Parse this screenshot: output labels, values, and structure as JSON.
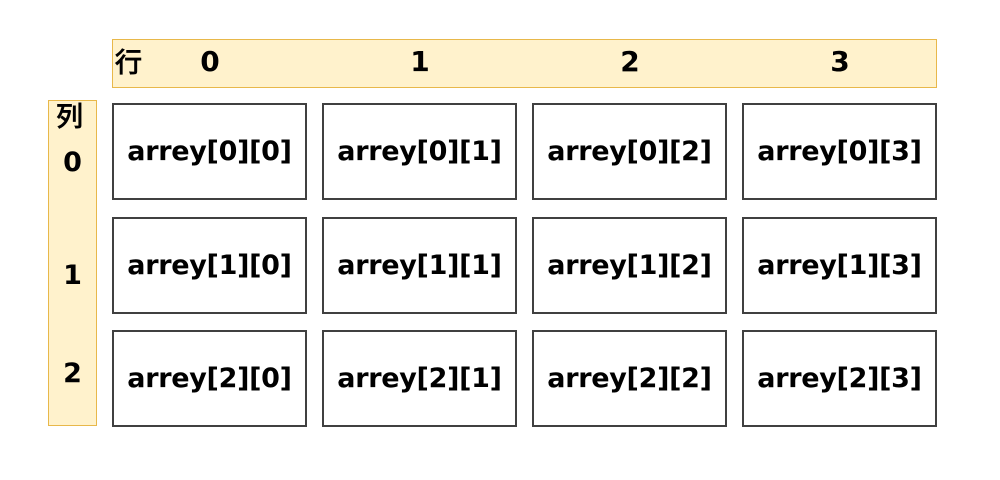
{
  "header": {
    "label": "行",
    "columns": [
      "0",
      "1",
      "2",
      "3"
    ]
  },
  "side": {
    "label": "列",
    "rows": [
      "0",
      "1",
      "2"
    ]
  },
  "cells": [
    [
      "arrey[0][0]",
      "arrey[0][1]",
      "arrey[0][2]",
      "arrey[0][3]"
    ],
    [
      "arrey[1][0]",
      "arrey[1][1]",
      "arrey[1][2]",
      "arrey[1][3]"
    ],
    [
      "arrey[2][0]",
      "arrey[2][1]",
      "arrey[2][2]",
      "arrey[2][3]"
    ]
  ],
  "colors": {
    "header_fill": "#fff2cc",
    "header_border": "#e8b84a",
    "cell_border": "#404040"
  }
}
